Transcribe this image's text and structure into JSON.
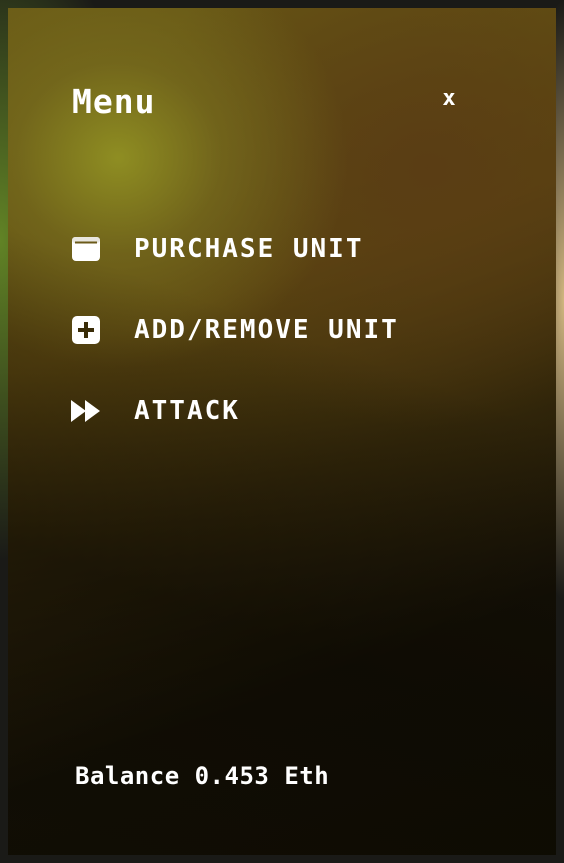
{
  "menu": {
    "title": "Menu",
    "close_label": "x",
    "items": [
      {
        "label": "PURCHASE UNIT",
        "icon": "wallet-icon"
      },
      {
        "label": "ADD/REMOVE UNIT",
        "icon": "plus-square-icon"
      },
      {
        "label": "ATTACK",
        "icon": "fast-forward-icon"
      }
    ]
  },
  "balance": {
    "label": "Balance",
    "amount": "0.453",
    "currency": "Eth"
  },
  "colors": {
    "text": "#ffffff",
    "panel_top": "#6a5a16",
    "panel_bottom": "#120f03"
  }
}
